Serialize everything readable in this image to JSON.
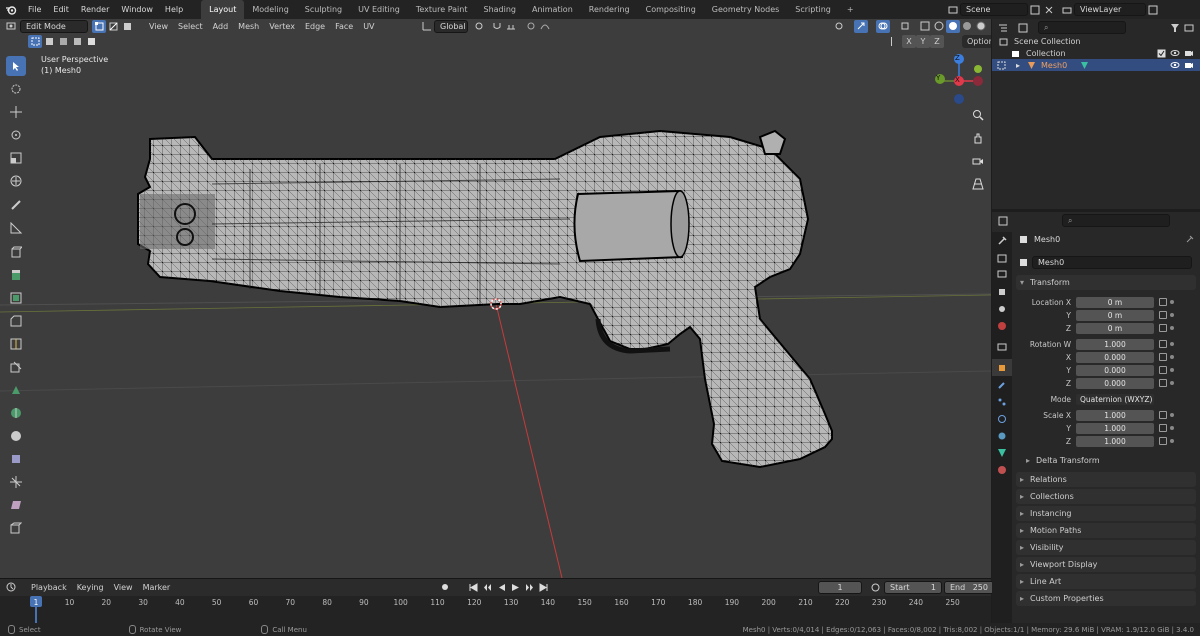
{
  "topbar": {
    "menus": [
      "File",
      "Edit",
      "Render",
      "Window",
      "Help"
    ],
    "workspaces": [
      "Layout",
      "Modeling",
      "Sculpting",
      "UV Editing",
      "Texture Paint",
      "Shading",
      "Animation",
      "Rendering",
      "Compositing",
      "Geometry Nodes",
      "Scripting"
    ],
    "active_workspace": "Layout",
    "add_tab": "+",
    "scene": "Scene",
    "view_layer": "ViewLayer"
  },
  "viewport_header": {
    "mode": "Edit Mode",
    "menus": [
      "View",
      "Select",
      "Add",
      "Mesh",
      "Vertex",
      "Edge",
      "Face",
      "UV"
    ],
    "orientation": "Global",
    "axes": [
      "X",
      "Y",
      "Z"
    ],
    "options": "Options"
  },
  "viewport": {
    "perspective_label": "User Perspective",
    "object_label": "(1) Mesh0",
    "gizmo": {
      "x": "X",
      "y": "Y",
      "z": "Z"
    }
  },
  "timeline": {
    "menus": [
      "Playback",
      "Keying",
      "View",
      "Marker"
    ],
    "current_frame": "1",
    "start_label": "Start",
    "start": "1",
    "end_label": "End",
    "end": "250",
    "ruler_marks": [
      "1",
      "10",
      "20",
      "30",
      "40",
      "50",
      "60",
      "70",
      "80",
      "90",
      "100",
      "110",
      "120",
      "130",
      "140",
      "150",
      "160",
      "170",
      "180",
      "190",
      "200",
      "210",
      "220",
      "230",
      "240",
      "250"
    ]
  },
  "statusbar": {
    "select": "Select",
    "rotate": "Rotate View",
    "menu": "Call Menu",
    "stats": "Mesh0 | Verts:0/4,014 | Edges:0/12,063 | Faces:0/8,002 | Tris:8,002 | Objects:1/1 | Memory: 29.6 MiB | VRAM: 1.9/12.0 GiB | 3.4.0"
  },
  "outliner": {
    "root": "Scene Collection",
    "collection": "Collection",
    "object": "Mesh0"
  },
  "properties": {
    "object_name": "Mesh0",
    "mesh_name": "Mesh0",
    "transform_title": "Transform",
    "location_label": "Location X",
    "location": [
      "0 m",
      "0 m",
      "0 m"
    ],
    "rotation_label": "Rotation W",
    "rotation": [
      "1.000",
      "0.000",
      "0.000",
      "0.000"
    ],
    "mode_label": "Mode",
    "mode_value": "Quaternion (WXYZ)",
    "scale_label": "Scale X",
    "scale": [
      "1.000",
      "1.000",
      "1.000"
    ],
    "axis_y": "Y",
    "axis_z": "Z",
    "axis_x": "X",
    "delta_transform": "Delta Transform",
    "panels": [
      "Relations",
      "Collections",
      "Instancing",
      "Motion Paths",
      "Visibility",
      "Viewport Display",
      "Line Art",
      "Custom Properties"
    ]
  },
  "colors": {
    "accent": "#4772b3",
    "viewport_bg": "#3d3d3d",
    "axis_x": "#e0394a",
    "axis_y": "#8ab833",
    "axis_z": "#3c7ee0"
  }
}
